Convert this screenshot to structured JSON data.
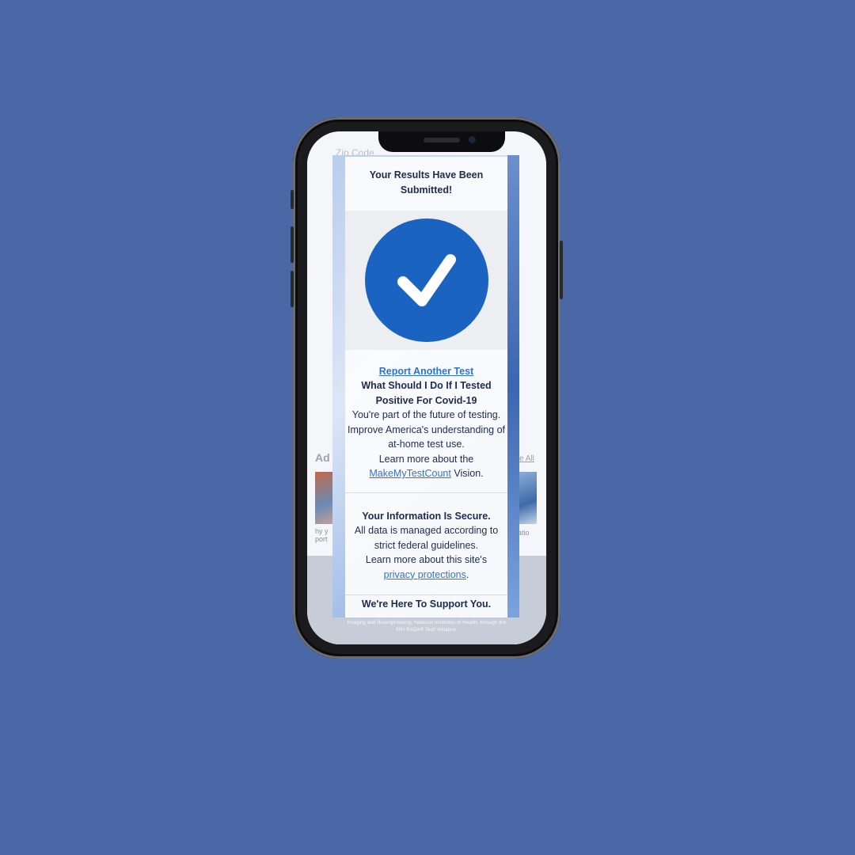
{
  "background_color": "#4a68a6",
  "bg_page": {
    "zip_label": "Zip Code",
    "ad_label": "Ad",
    "see_all": "e All",
    "caption_left": "hy y\nport",
    "caption_right": "atio"
  },
  "modal": {
    "title": "Your Results Have Been Submitted!",
    "check_icon": "checkmark-circle-icon",
    "report_link": "Report Another Test",
    "positive_heading": "What Should I Do If I Tested Positive For Covid-19",
    "future_text": "You're part of the future of testing. Improve America's understanding of at-home test use.",
    "learn_more_prefix": "Learn more about the",
    "vision_link": "MakeMyTestCount",
    "vision_suffix": "Vision.",
    "secure_heading": "Your Information Is Secure.",
    "secure_text": "All data is managed according to strict federal guidelines.",
    "privacy_prefix": "Learn more about this site's",
    "privacy_link": "privacy protections",
    "privacy_suffix": ".",
    "support_heading": "We're Here To Support You."
  },
  "footer_note": "Imaging and Bioengineering, National Institutes of Health, through the NIH RADx® Tech initiative.",
  "colors": {
    "accent": "#1a63c0",
    "link": "#2f73d1",
    "text": "#1d2b4f"
  }
}
